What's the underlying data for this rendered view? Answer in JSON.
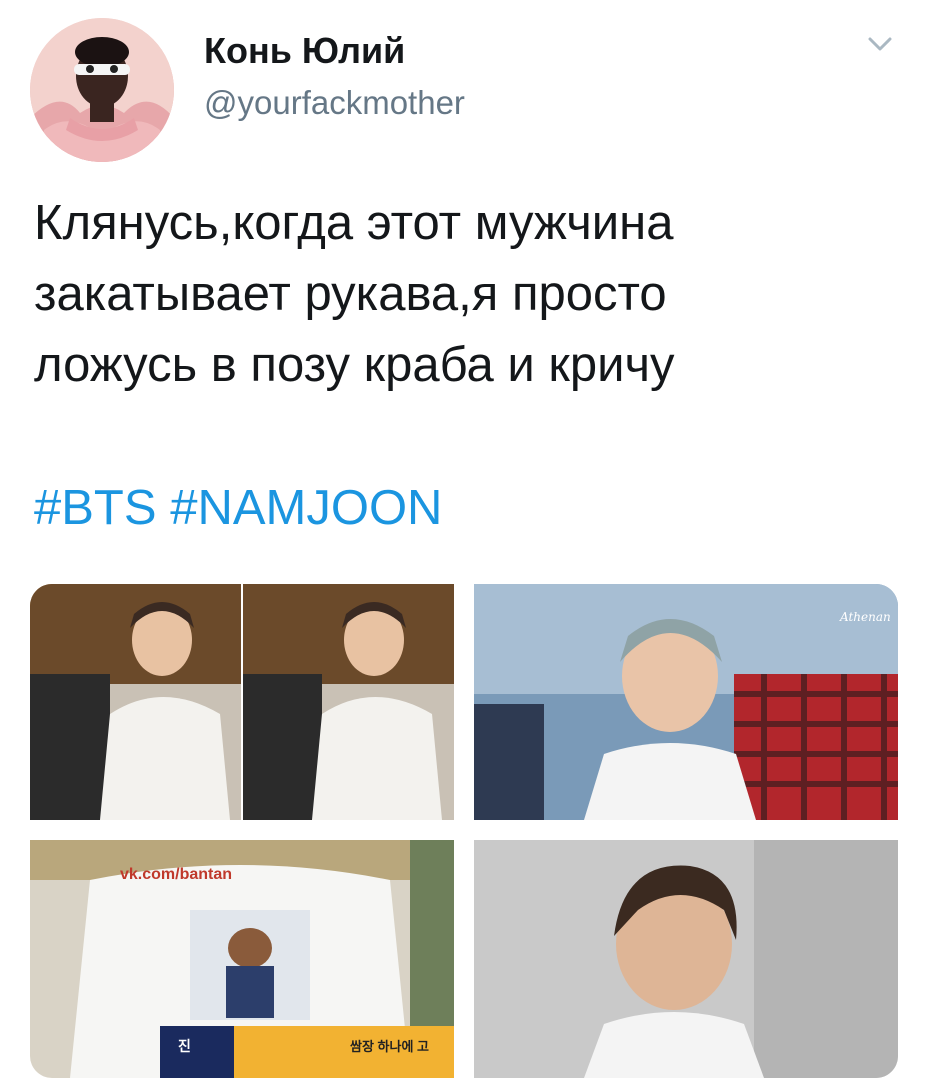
{
  "author": {
    "display_name": "Конь Юлий",
    "handle": "@yourfackmother",
    "avatar_icon": "avatar-photo"
  },
  "menu": {
    "icon": "chevron-down-icon"
  },
  "tweet": {
    "lines": [
      "Клянусь,когда этот мужчина",
      "закатывает рукава,я просто",
      "ложусь в позу краба и кричу"
    ],
    "hashtags": [
      "#BTS",
      "#NAMJOON"
    ]
  },
  "media": {
    "watermark": "vk.com/bantan",
    "caption_left": "진",
    "caption_right": "쌈장 하나에 고",
    "signature": "Athenan"
  },
  "colors": {
    "text": "#14171a",
    "secondary": "#657786",
    "accent": "#1b95e0"
  }
}
